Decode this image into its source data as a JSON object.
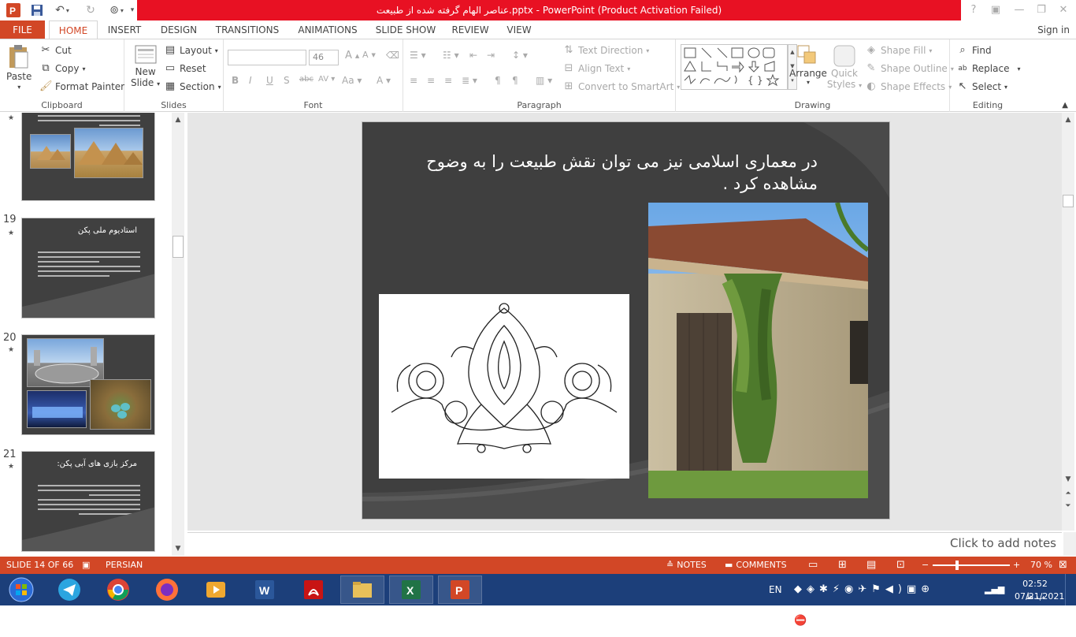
{
  "titlebar": {
    "title": "عناصر الهام گرفته شده از طبیعت.pptx -  PowerPoint (Product Activation Failed)"
  },
  "tabs": [
    "FILE",
    "HOME",
    "INSERT",
    "DESIGN",
    "TRANSITIONS",
    "ANIMATIONS",
    "SLIDE SHOW",
    "REVIEW",
    "VIEW"
  ],
  "signin": "Sign in",
  "ribbon": {
    "clipboard": {
      "label": "Clipboard",
      "paste": "Paste",
      "cut": "Cut",
      "copy": "Copy",
      "format_painter": "Format Painter"
    },
    "slides": {
      "label": "Slides",
      "new_slide_line1": "New",
      "new_slide_line2": "Slide",
      "layout": "Layout",
      "reset": "Reset",
      "section": "Section"
    },
    "font": {
      "label": "Font",
      "font_name": "",
      "font_size": "46"
    },
    "paragraph": {
      "label": "Paragraph",
      "text_direction": "Text Direction",
      "align_text": "Align Text",
      "convert_smartart": "Convert to SmartArt"
    },
    "drawing": {
      "label": "Drawing",
      "arrange": "Arrange",
      "quick_styles_1": "Quick",
      "quick_styles_2": "Styles",
      "shape_fill": "Shape Fill",
      "shape_outline": "Shape Outline",
      "shape_effects": "Shape Effects"
    },
    "editing": {
      "label": "Editing",
      "find": "Find",
      "replace": "Replace",
      "select": "Select"
    }
  },
  "thumbnails": [
    {
      "num": "19",
      "title": "استادیوم ملی پکن"
    },
    {
      "num": "20",
      "title": ""
    },
    {
      "num": "21",
      "title": "مرکز بازی های آبی پکن:"
    }
  ],
  "slide": {
    "title": "در معماری اسلامی نیز می توان نقش طبیعت را به وضوح مشاهده کرد ."
  },
  "notes_placeholder": "Click to add notes",
  "statusbar": {
    "slide_info": "SLIDE 14 OF 66",
    "language": "PERSIAN",
    "notes": "NOTES",
    "comments": "COMMENTS",
    "zoom": "70 %"
  },
  "taskbar": {
    "lang": "EN",
    "time": "02:52 ب.ظ",
    "date": "07/21/2021"
  }
}
